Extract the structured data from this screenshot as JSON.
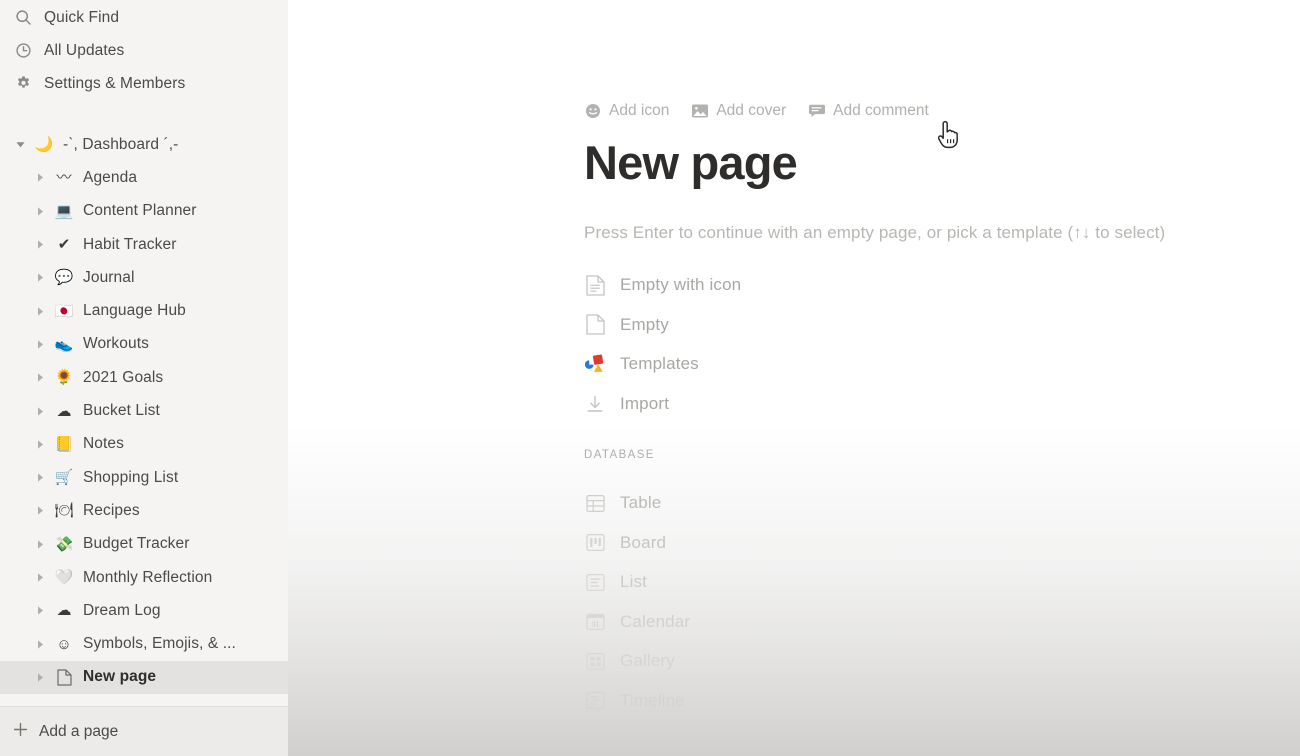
{
  "sidebar": {
    "top_nav": [
      {
        "label": "Quick Find",
        "icon": "search-icon"
      },
      {
        "label": "All Updates",
        "icon": "clock-icon"
      },
      {
        "label": "Settings & Members",
        "icon": "gear-icon"
      }
    ],
    "tree": [
      {
        "label": "-ˋ, Dashboard ´,-",
        "emoji": "🌙",
        "level": "root",
        "caret": "down",
        "selected": false
      },
      {
        "label": "Agenda",
        "emoji": "〰",
        "level": "child",
        "caret": "right",
        "selected": false
      },
      {
        "label": "Content Planner",
        "emoji": "💻",
        "level": "child",
        "caret": "right",
        "selected": false
      },
      {
        "label": "Habit Tracker",
        "emoji": "✔",
        "level": "child",
        "caret": "right",
        "selected": false
      },
      {
        "label": "Journal",
        "emoji": "💬",
        "level": "child",
        "caret": "right",
        "selected": false
      },
      {
        "label": "Language Hub",
        "emoji": "🇯🇵",
        "level": "child",
        "caret": "right",
        "selected": false
      },
      {
        "label": "Workouts",
        "emoji": "👟",
        "level": "child",
        "caret": "right",
        "selected": false
      },
      {
        "label": "2021 Goals",
        "emoji": "🌻",
        "level": "child",
        "caret": "right",
        "selected": false
      },
      {
        "label": "Bucket List",
        "emoji": "☁",
        "level": "child",
        "caret": "right",
        "selected": false
      },
      {
        "label": "Notes",
        "emoji": "📒",
        "level": "child",
        "caret": "right",
        "selected": false
      },
      {
        "label": "Shopping List",
        "emoji": "🛒",
        "level": "child",
        "caret": "right",
        "selected": false
      },
      {
        "label": "Recipes",
        "emoji": "🍽",
        "level": "child",
        "caret": "right",
        "selected": false
      },
      {
        "label": "Budget Tracker",
        "emoji": "💸",
        "level": "child",
        "caret": "right",
        "selected": false
      },
      {
        "label": "Monthly Reflection",
        "emoji": "🤍",
        "level": "child",
        "caret": "right",
        "selected": false
      },
      {
        "label": "Dream Log",
        "emoji": "☁",
        "level": "child",
        "caret": "right",
        "selected": false
      },
      {
        "label": "Symbols, Emojis, & ...",
        "emoji": "☺",
        "level": "child",
        "caret": "right",
        "selected": false
      },
      {
        "label": "New page",
        "emoji": "page",
        "level": "child",
        "caret": "right",
        "selected": true
      }
    ],
    "footer": {
      "label": "Add a page",
      "icon": "plus-icon"
    }
  },
  "main": {
    "actions": [
      {
        "label": "Add icon",
        "icon": "emoji-face-icon"
      },
      {
        "label": "Add cover",
        "icon": "image-icon"
      },
      {
        "label": "Add comment",
        "icon": "comment-icon"
      }
    ],
    "title": "New page",
    "hint": "Press Enter to continue with an empty page, or pick a template (↑↓ to select)",
    "options": [
      {
        "label": "Empty with icon",
        "icon": "document-lines-icon"
      },
      {
        "label": "Empty",
        "icon": "document-blank-icon"
      },
      {
        "label": "Templates",
        "icon": "templates-shapes-icon"
      },
      {
        "label": "Import",
        "icon": "import-arrow-icon"
      }
    ],
    "database_section_label": "DATABASE",
    "database_options": [
      {
        "label": "Table",
        "icon": "table-icon"
      },
      {
        "label": "Board",
        "icon": "board-icon"
      },
      {
        "label": "List",
        "icon": "list-icon"
      },
      {
        "label": "Calendar",
        "icon": "calendar-icon"
      },
      {
        "label": "Gallery",
        "icon": "gallery-icon"
      },
      {
        "label": "Timeline",
        "icon": "timeline-icon"
      }
    ]
  },
  "colors": {
    "sidebar_bg": "#f5f4f2",
    "selected_row_bg": "#e4e2e0",
    "title_text": "#2e2d2b",
    "muted_text": "#a9a7a3",
    "templates_blue": "#2a7ad6",
    "templates_red": "#e03b2f",
    "templates_yellow": "#f5b32d"
  }
}
